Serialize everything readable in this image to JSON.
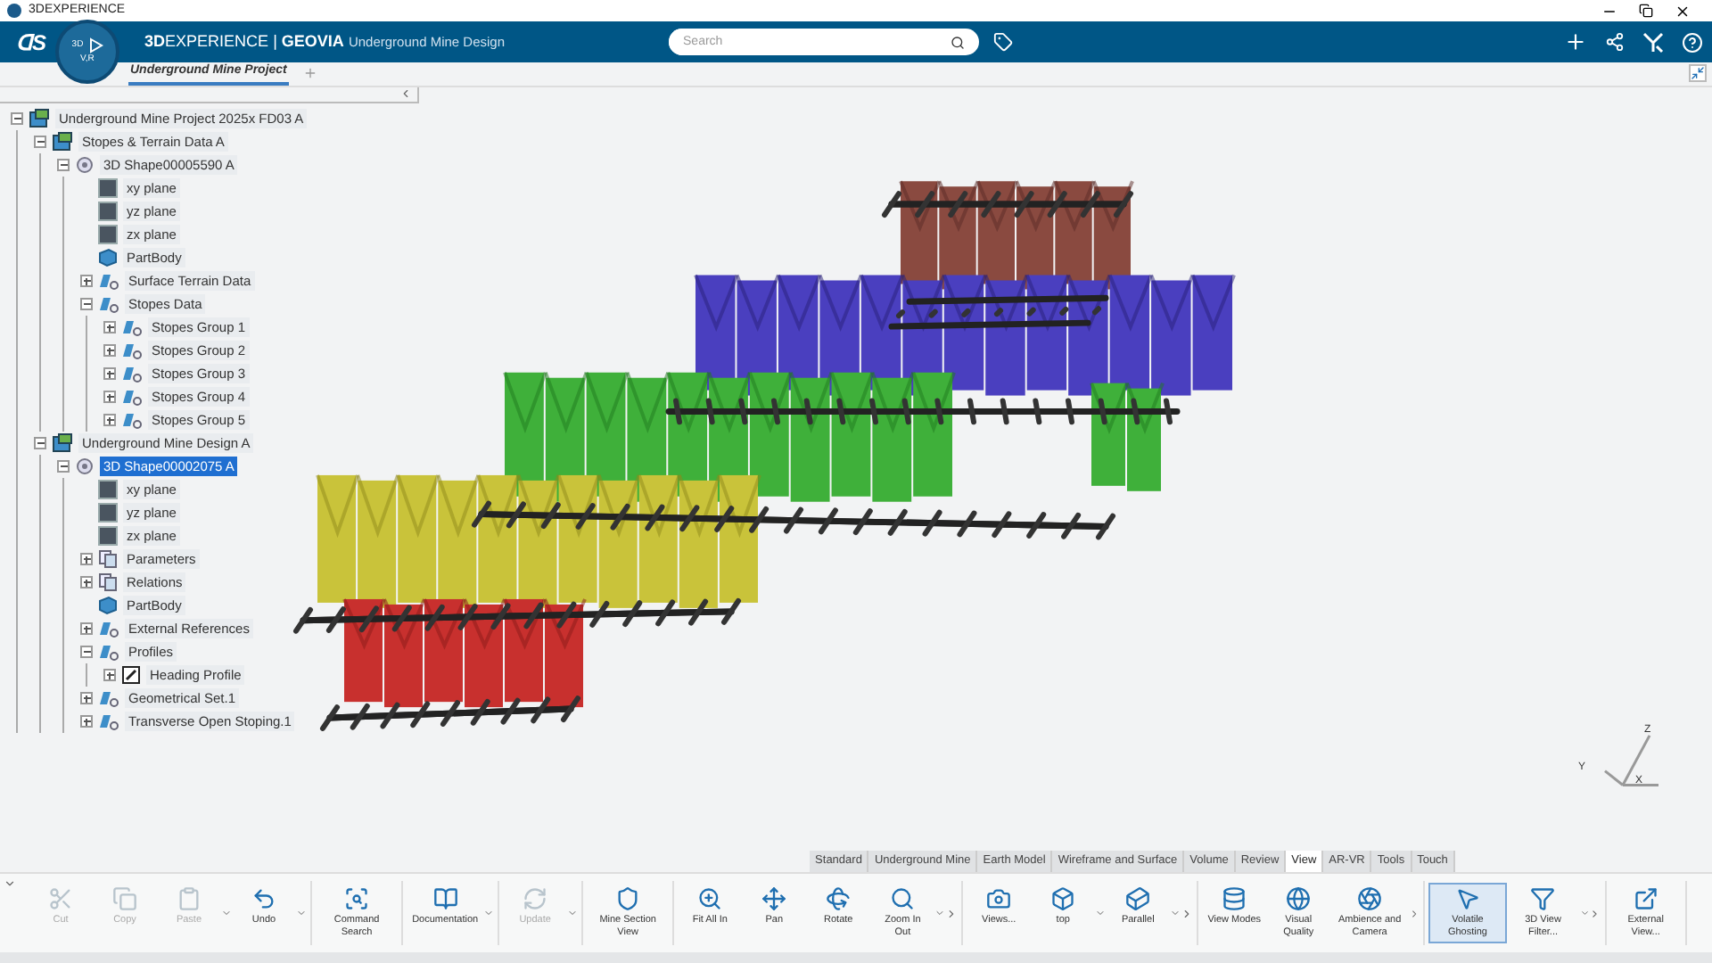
{
  "window": {
    "title": "3DEXPERIENCE"
  },
  "header": {
    "logo": "ᗡS",
    "brand_bold": "3D",
    "brand_rest": "EXPERIENCE",
    "separator": "|",
    "product": "GEOVIA",
    "app": "Underground Mine Design",
    "compass": {
      "left": "3D",
      "bottom": "V,R"
    },
    "search": {
      "placeholder": "Search"
    }
  },
  "doc_tabs": [
    {
      "label": "Underground Mine Project",
      "selected": true
    }
  ],
  "tree": [
    {
      "label": "Underground Mine Project 2025x FD03 A",
      "kind": "product",
      "selected": false,
      "expanded": true,
      "children": [
        {
          "label": "Stopes & Terrain Data A",
          "kind": "product",
          "selected": false,
          "expanded": true,
          "children": [
            {
              "label": "3D Shape00005590 A",
              "kind": "shape",
              "selected": false,
              "expanded": true,
              "children": [
                {
                  "label": "xy plane",
                  "kind": "plane",
                  "selected": false
                },
                {
                  "label": "yz plane",
                  "kind": "plane",
                  "selected": false
                },
                {
                  "label": "zx plane",
                  "kind": "plane",
                  "selected": false
                },
                {
                  "label": "PartBody",
                  "kind": "body",
                  "selected": false
                },
                {
                  "label": "Surface Terrain Data",
                  "kind": "set",
                  "selected": false,
                  "expanded": false
                },
                {
                  "label": "Stopes Data",
                  "kind": "set",
                  "selected": false,
                  "expanded": true,
                  "children": [
                    {
                      "label": "Stopes Group 1",
                      "kind": "set",
                      "selected": false,
                      "expanded": false
                    },
                    {
                      "label": "Stopes Group 2",
                      "kind": "set",
                      "selected": false,
                      "expanded": false
                    },
                    {
                      "label": "Stopes Group 3",
                      "kind": "set",
                      "selected": false,
                      "expanded": false
                    },
                    {
                      "label": "Stopes Group 4",
                      "kind": "set",
                      "selected": false,
                      "expanded": false
                    },
                    {
                      "label": "Stopes Group 5",
                      "kind": "set",
                      "selected": false,
                      "expanded": false
                    }
                  ]
                }
              ]
            }
          ]
        },
        {
          "label": "Underground Mine Design A",
          "kind": "product",
          "selected": false,
          "expanded": true,
          "children": [
            {
              "label": "3D Shape00002075 A",
              "kind": "shape",
              "selected": true,
              "expanded": true,
              "children": [
                {
                  "label": "xy plane",
                  "kind": "plane",
                  "selected": false
                },
                {
                  "label": "yz plane",
                  "kind": "plane",
                  "selected": false
                },
                {
                  "label": "zx plane",
                  "kind": "plane",
                  "selected": false
                },
                {
                  "label": "Parameters",
                  "kind": "param",
                  "selected": false,
                  "expanded": false
                },
                {
                  "label": "Relations",
                  "kind": "param",
                  "selected": false,
                  "expanded": false
                },
                {
                  "label": "PartBody",
                  "kind": "body",
                  "selected": false
                },
                {
                  "label": "External References",
                  "kind": "set",
                  "selected": false,
                  "expanded": false
                },
                {
                  "label": "Profiles",
                  "kind": "set",
                  "selected": false,
                  "expanded": true,
                  "children": [
                    {
                      "label": "Heading Profile",
                      "kind": "sketch",
                      "selected": false,
                      "expanded": false
                    }
                  ]
                },
                {
                  "label": "Geometrical Set.1",
                  "kind": "set",
                  "selected": false,
                  "expanded": false
                },
                {
                  "label": "Transverse Open Stoping.1",
                  "kind": "set",
                  "selected": false,
                  "expanded": false
                }
              ]
            }
          ]
        }
      ]
    }
  ],
  "viewport": {
    "axes": {
      "z": "Z",
      "y": "Y",
      "x": "X"
    }
  },
  "action_bar_tabs": [
    {
      "label": "Standard",
      "selected": false
    },
    {
      "label": "Underground Mine",
      "selected": false
    },
    {
      "label": "Earth Model",
      "selected": false
    },
    {
      "label": "Wireframe and Surface",
      "selected": false
    },
    {
      "label": "Volume",
      "selected": false
    },
    {
      "label": "Review",
      "selected": false
    },
    {
      "label": "View",
      "selected": true
    },
    {
      "label": "AR-VR",
      "selected": false
    },
    {
      "label": "Tools",
      "selected": false
    },
    {
      "label": "Touch",
      "selected": false
    }
  ],
  "toolbar_groups": [
    [
      {
        "label": "Cut",
        "disabled": true,
        "dropdown": false,
        "selected": false
      },
      {
        "label": "Copy",
        "disabled": true,
        "dropdown": false,
        "selected": false
      },
      {
        "label": "Paste",
        "disabled": true,
        "dropdown": true,
        "selected": false
      },
      {
        "label": "Undo",
        "disabled": false,
        "dropdown": true,
        "selected": false
      }
    ],
    [
      {
        "label": "Command Search",
        "disabled": false,
        "dropdown": false,
        "selected": false
      }
    ],
    [
      {
        "label": "Documentation",
        "disabled": false,
        "dropdown": true,
        "selected": false
      }
    ],
    [
      {
        "label": "Update",
        "disabled": true,
        "dropdown": true,
        "selected": false
      }
    ],
    [
      {
        "label": "Mine Section View",
        "disabled": false,
        "dropdown": false,
        "selected": false
      }
    ],
    [
      {
        "label": "Fit All In",
        "disabled": false,
        "dropdown": false,
        "selected": false
      },
      {
        "label": "Pan",
        "disabled": false,
        "dropdown": false,
        "selected": false
      },
      {
        "label": "Rotate",
        "disabled": false,
        "dropdown": false,
        "selected": false
      },
      {
        "label": "Zoom In Out",
        "disabled": false,
        "dropdown": true,
        "selected": false
      }
    ],
    [
      {
        "label": "Views...",
        "disabled": false,
        "dropdown": false,
        "selected": false
      },
      {
        "label": "top",
        "disabled": false,
        "dropdown": true,
        "selected": false
      },
      {
        "label": "Parallel",
        "disabled": false,
        "dropdown": true,
        "selected": false
      }
    ],
    [
      {
        "label": "View Modes",
        "disabled": false,
        "dropdown": false,
        "selected": false
      },
      {
        "label": "Visual Quality",
        "disabled": false,
        "dropdown": false,
        "selected": false
      },
      {
        "label": "Ambience and Camera",
        "disabled": false,
        "dropdown": false,
        "selected": false
      }
    ],
    [
      {
        "label": "Volatile Ghosting",
        "disabled": false,
        "dropdown": false,
        "selected": true
      },
      {
        "label": "3D View Filter...",
        "disabled": false,
        "dropdown": true,
        "selected": false
      }
    ],
    [
      {
        "label": "External View...",
        "disabled": false,
        "dropdown": false,
        "selected": false
      }
    ]
  ]
}
